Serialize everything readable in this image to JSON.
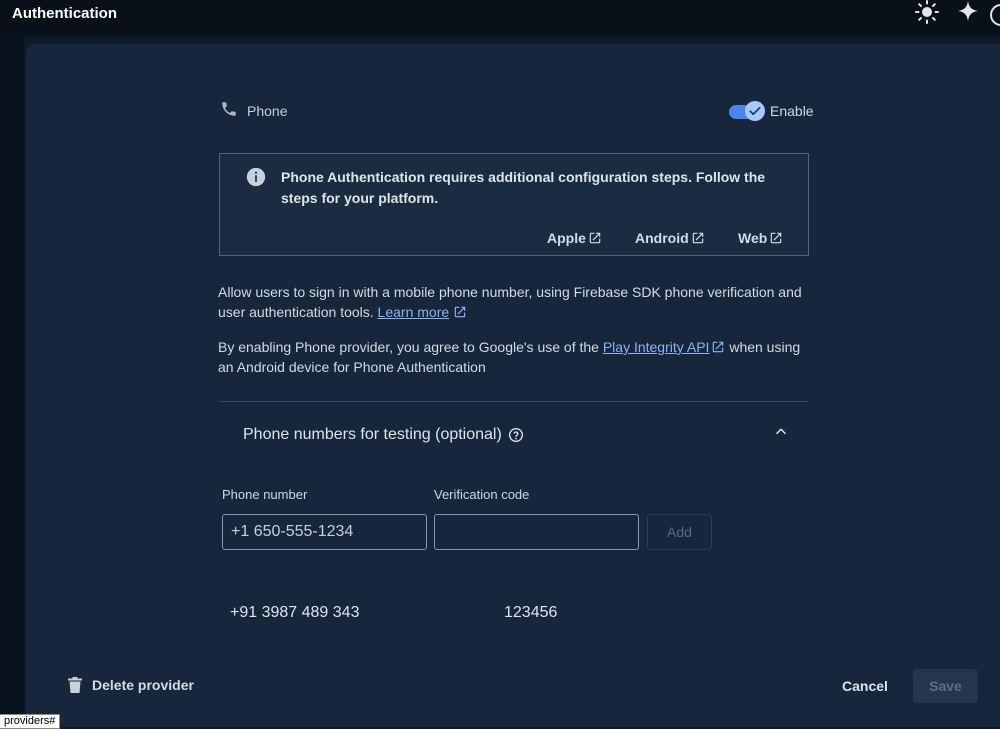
{
  "header": {
    "title": "Authentication",
    "icons": [
      "sun-icon",
      "sparkle-icon"
    ]
  },
  "provider": {
    "name": "Phone",
    "toggle_label": "Enable",
    "enabled": true
  },
  "info_box": {
    "text": "Phone Authentication requires additional configuration steps. Follow the steps for your platform.",
    "links": [
      "Apple",
      "Android",
      "Web"
    ]
  },
  "description": {
    "line1": "Allow users to sign in with a mobile phone number, using Firebase SDK phone verification and user authentication tools.",
    "learn_more": "Learn more",
    "line2_prefix": "By enabling Phone provider, you agree to Google's use of the",
    "play_integrity": "Play Integrity API",
    "line2_suffix": "when using an Android device for Phone Authentication"
  },
  "testing": {
    "title": "Phone numbers for testing (optional)",
    "phone_label": "Phone number",
    "code_label": "Verification code",
    "phone_placeholder": "+1 650-555-1234",
    "code_placeholder": "",
    "add_label": "Add",
    "entries": [
      {
        "phone": "+91 3987 489 343",
        "code": "123456"
      }
    ]
  },
  "footer": {
    "delete_label": "Delete provider",
    "cancel_label": "Cancel",
    "save_label": "Save"
  },
  "status_bar": {
    "url": "providers#"
  },
  "colors": {
    "accent": "#8ab4f8",
    "toggle_on": "#4a86e8",
    "panel": "#17263a",
    "background": "#0f1a27"
  }
}
